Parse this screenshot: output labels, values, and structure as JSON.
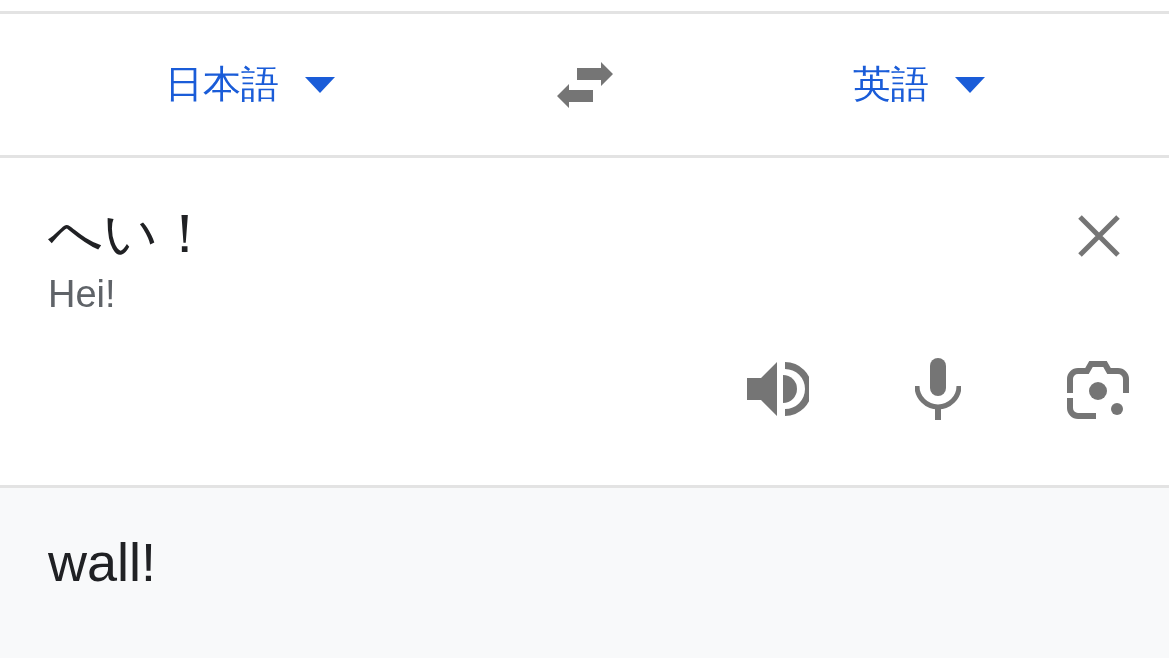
{
  "language_bar": {
    "source_language": "日本語",
    "target_language": "英語"
  },
  "input": {
    "text": "へい！",
    "transliteration": "Hei!"
  },
  "output": {
    "text": "wall!"
  }
}
